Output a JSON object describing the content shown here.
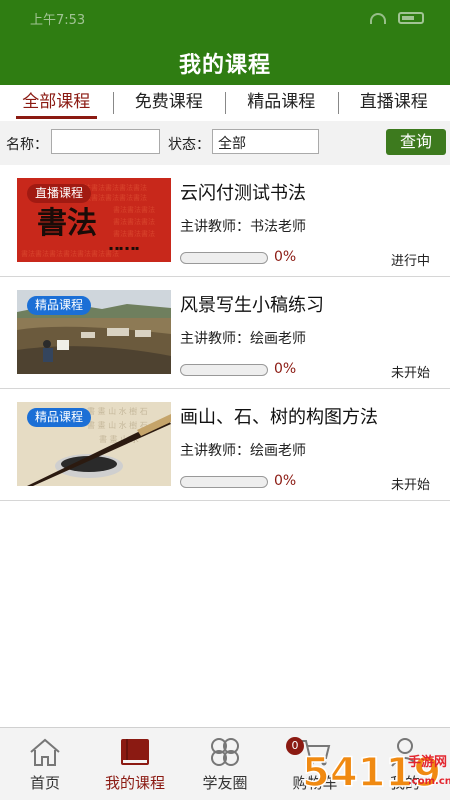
{
  "status_bar": {
    "time": "上午7:53"
  },
  "header": {
    "title": "我的课程"
  },
  "tabs": [
    {
      "label": "全部课程",
      "active": true
    },
    {
      "label": "免费课程",
      "active": false
    },
    {
      "label": "精品课程",
      "active": false
    },
    {
      "label": "直播课程",
      "active": false
    }
  ],
  "filter": {
    "name_label": "名称：",
    "name_value": "",
    "status_label": "状态：",
    "status_value": "全部",
    "query_button": "查询"
  },
  "courses": [
    {
      "badge": "直播课程",
      "badge_color": "#a11a12",
      "title": "云闪付测试书法",
      "teacher": "主讲教师：书法老师",
      "progress": 0,
      "progress_text": "0%",
      "status": "进行中",
      "thumb_text": "書法"
    },
    {
      "badge": "精品课程",
      "badge_color": "#1b6fd6",
      "title": "风景写生小稿练习",
      "teacher": "主讲教师：绘画老师",
      "progress": 0,
      "progress_text": "0%",
      "status": "未开始"
    },
    {
      "badge": "精品课程",
      "badge_color": "#1b6fd6",
      "title": "画山、石、树的构图方法",
      "teacher": "主讲教师：绘画老师",
      "progress": 0,
      "progress_text": "0%",
      "status": "未开始"
    }
  ],
  "bottom_nav": [
    {
      "label": "首页",
      "icon": "home-icon",
      "active": false
    },
    {
      "label": "我的课程",
      "icon": "book-icon",
      "active": true
    },
    {
      "label": "学友圈",
      "icon": "clover-icon",
      "active": false
    },
    {
      "label": "购物车",
      "icon": "cart-icon",
      "active": false
    },
    {
      "label": "我的",
      "icon": "user-icon",
      "active": false
    }
  ],
  "cart_badge": "0",
  "watermark": {
    "text": "54119",
    "suffix": "手游网",
    "domain": ".com.cn"
  },
  "colors": {
    "header_green": "#2f7d12",
    "accent_red": "#8b1a12",
    "button_green": "#3d7a1e",
    "badge_blue": "#1b6fd6"
  }
}
